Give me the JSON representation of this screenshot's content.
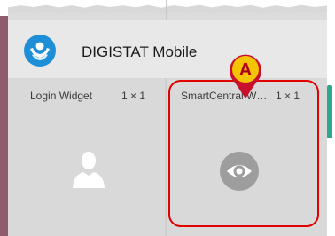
{
  "header": {
    "app_title": "DIGISTAT Mobile",
    "logo_icon": "digistat-hands-logo-icon"
  },
  "widgets": [
    {
      "name": "Login Widget",
      "size": "1 × 1",
      "icon": "user-silhouette-icon"
    },
    {
      "name": "SmartCentral W…",
      "size": "1 × 1",
      "icon": "eye-icon"
    }
  ],
  "annotation": {
    "callout_label": "A",
    "callout_color": "#f5c400",
    "highlight_color": "#e00000"
  },
  "colors": {
    "accent_left_bar": "#8e5c6c",
    "logo_blue": "#1e8ed6",
    "scroll_thumb": "#2fa78e"
  }
}
